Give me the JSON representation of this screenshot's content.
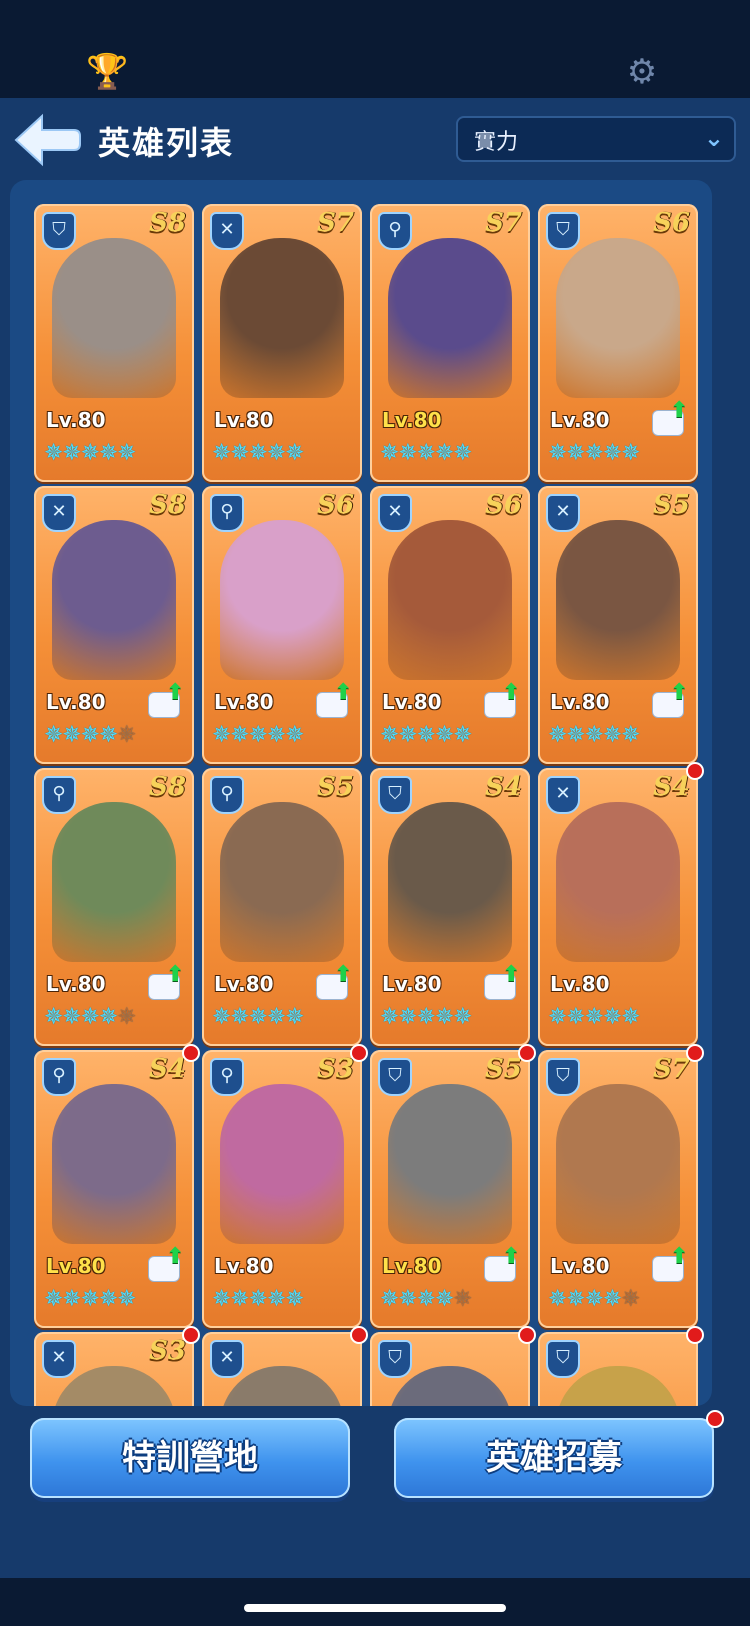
{
  "header": {
    "title": "英雄列表",
    "sort_selected": "實力"
  },
  "icons": {
    "trophy": "trophy-icon",
    "settings": "gear-icon",
    "back": "back-arrow-icon",
    "dropdown": "chevron-down-icon"
  },
  "colors": {
    "card_orange": "#f59038",
    "star_cyan": "#4fe0ff",
    "rank_gold": "#f7d25a",
    "notification_red": "#e11b1b",
    "button_blue": "#3f93ee"
  },
  "heroes": [
    {
      "role": "shield",
      "rank": "S8",
      "level": "Lv.80",
      "stars_filled": 5,
      "upgrade": false,
      "notify": false,
      "gold_level": false
    },
    {
      "role": "crossbow",
      "rank": "S7",
      "level": "Lv.80",
      "stars_filled": 5,
      "upgrade": false,
      "notify": false,
      "gold_level": false
    },
    {
      "role": "staff",
      "rank": "S7",
      "level": "Lv.80",
      "stars_filled": 5,
      "upgrade": false,
      "notify": false,
      "gold_level": true
    },
    {
      "role": "shield",
      "rank": "S6",
      "level": "Lv.80",
      "stars_filled": 5,
      "upgrade": true,
      "notify": false,
      "gold_level": false
    },
    {
      "role": "crossbow",
      "rank": "S8",
      "level": "Lv.80",
      "stars_filled": 4,
      "upgrade": true,
      "notify": false,
      "gold_level": false
    },
    {
      "role": "staff",
      "rank": "S6",
      "level": "Lv.80",
      "stars_filled": 5,
      "upgrade": true,
      "notify": false,
      "gold_level": false
    },
    {
      "role": "crossbow",
      "rank": "S6",
      "level": "Lv.80",
      "stars_filled": 5,
      "upgrade": true,
      "notify": false,
      "gold_level": false
    },
    {
      "role": "crossbow",
      "rank": "S5",
      "level": "Lv.80",
      "stars_filled": 5,
      "upgrade": true,
      "notify": false,
      "gold_level": false
    },
    {
      "role": "staff",
      "rank": "S8",
      "level": "Lv.80",
      "stars_filled": 4,
      "upgrade": true,
      "notify": false,
      "gold_level": false
    },
    {
      "role": "staff",
      "rank": "S5",
      "level": "Lv.80",
      "stars_filled": 5,
      "upgrade": true,
      "notify": false,
      "gold_level": false
    },
    {
      "role": "shield",
      "rank": "S4",
      "level": "Lv.80",
      "stars_filled": 5,
      "upgrade": true,
      "notify": false,
      "gold_level": false
    },
    {
      "role": "crossbow",
      "rank": "S4",
      "level": "Lv.80",
      "stars_filled": 5,
      "upgrade": false,
      "notify": true,
      "gold_level": false
    },
    {
      "role": "staff",
      "rank": "S4",
      "level": "Lv.80",
      "stars_filled": 5,
      "upgrade": true,
      "notify": true,
      "gold_level": true
    },
    {
      "role": "staff",
      "rank": "S3",
      "level": "Lv.80",
      "stars_filled": 5,
      "upgrade": false,
      "notify": true,
      "gold_level": false
    },
    {
      "role": "shield",
      "rank": "S5",
      "level": "Lv.80",
      "stars_filled": 4,
      "upgrade": true,
      "notify": true,
      "gold_level": true
    },
    {
      "role": "shield",
      "rank": "S7",
      "level": "Lv.80",
      "stars_filled": 4,
      "upgrade": true,
      "notify": true,
      "gold_level": false
    },
    {
      "role": "crossbow",
      "rank": "S3",
      "level": "",
      "stars_filled": 0,
      "upgrade": false,
      "notify": true,
      "gold_level": false
    },
    {
      "role": "crossbow",
      "rank": "",
      "level": "",
      "stars_filled": 0,
      "upgrade": false,
      "notify": true,
      "gold_level": false
    },
    {
      "role": "shield",
      "rank": "",
      "level": "",
      "stars_filled": 0,
      "upgrade": false,
      "notify": true,
      "gold_level": false
    },
    {
      "role": "shield",
      "rank": "",
      "level": "",
      "stars_filled": 0,
      "upgrade": false,
      "notify": true,
      "gold_level": false
    }
  ],
  "footer": {
    "left_button": "特訓營地",
    "right_button": "英雄招募"
  }
}
